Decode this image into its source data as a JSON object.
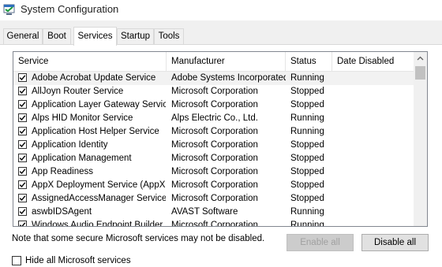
{
  "window": {
    "title": "System Configuration",
    "icon": "msconfig-icon"
  },
  "tabs": [
    {
      "label": "General",
      "active": false
    },
    {
      "label": "Boot",
      "active": false
    },
    {
      "label": "Services",
      "active": true
    },
    {
      "label": "Startup",
      "active": false
    },
    {
      "label": "Tools",
      "active": false
    }
  ],
  "columns": {
    "service": "Service",
    "manufacturer": "Manufacturer",
    "status": "Status",
    "date_disabled": "Date Disabled"
  },
  "services": [
    {
      "name": "Adobe Acrobat Update Service",
      "manufacturer": "Adobe Systems Incorporated",
      "status": "Running",
      "date_disabled": "",
      "checked": true,
      "selected": true
    },
    {
      "name": "AllJoyn Router Service",
      "manufacturer": "Microsoft Corporation",
      "status": "Stopped",
      "date_disabled": "",
      "checked": true
    },
    {
      "name": "Application Layer Gateway Service",
      "manufacturer": "Microsoft Corporation",
      "status": "Stopped",
      "date_disabled": "",
      "checked": true
    },
    {
      "name": "Alps HID Monitor Service",
      "manufacturer": "Alps Electric Co., Ltd.",
      "status": "Running",
      "date_disabled": "",
      "checked": true
    },
    {
      "name": "Application Host Helper Service",
      "manufacturer": "Microsoft Corporation",
      "status": "Running",
      "date_disabled": "",
      "checked": true
    },
    {
      "name": "Application Identity",
      "manufacturer": "Microsoft Corporation",
      "status": "Stopped",
      "date_disabled": "",
      "checked": true
    },
    {
      "name": "Application Management",
      "manufacturer": "Microsoft Corporation",
      "status": "Stopped",
      "date_disabled": "",
      "checked": true
    },
    {
      "name": "App Readiness",
      "manufacturer": "Microsoft Corporation",
      "status": "Stopped",
      "date_disabled": "",
      "checked": true
    },
    {
      "name": "AppX Deployment Service (AppX...",
      "manufacturer": "Microsoft Corporation",
      "status": "Stopped",
      "date_disabled": "",
      "checked": true
    },
    {
      "name": "AssignedAccessManager Service",
      "manufacturer": "Microsoft Corporation",
      "status": "Stopped",
      "date_disabled": "",
      "checked": true
    },
    {
      "name": "aswbIDSAgent",
      "manufacturer": "AVAST Software",
      "status": "Running",
      "date_disabled": "",
      "checked": true
    },
    {
      "name": "Windows Audio Endpoint Builder",
      "manufacturer": "Microsoft Corporation",
      "status": "Running",
      "date_disabled": "",
      "checked": true
    }
  ],
  "footer": {
    "note": "Note that some secure Microsoft services may not be disabled.",
    "enable_all": "Enable all",
    "disable_all": "Disable all",
    "hide_ms_label": "Hide all Microsoft services",
    "hide_ms_checked": false
  },
  "colors": {
    "selected_row": "#f2f2f2",
    "border": "#828790",
    "tab_bg": "#f0f0f0"
  }
}
